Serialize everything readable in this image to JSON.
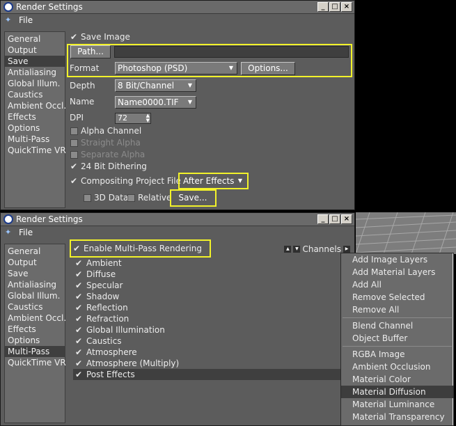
{
  "window1": {
    "title": "Render Settings",
    "menu": [
      "File"
    ],
    "sidebar": [
      "General",
      "Output",
      "Save",
      "Antialiasing",
      "Global Illum.",
      "Caustics",
      "Ambient Occl.",
      "Effects",
      "Options",
      "Multi-Pass",
      "QuickTime VR"
    ],
    "selected_sidebar": "Save",
    "save_image_label": "Save Image",
    "path_button": "Path...",
    "format_label": "Format",
    "format_value": "Photoshop (PSD)",
    "options_button": "Options...",
    "depth_label": "Depth",
    "depth_value": "8 Bit/Channel",
    "name_label": "Name",
    "name_value": "Name0000.TIF",
    "dpi_label": "DPI",
    "dpi_value": "72",
    "alpha_channel": "Alpha Channel",
    "straight_alpha": "Straight Alpha",
    "separate_alpha": "Separate Alpha",
    "dithering": "24 Bit Dithering",
    "compositing_label": "Compositing Project File",
    "compositing_value": "After Effects",
    "data_3d": "3D Data",
    "relative": "Relative",
    "save_button": "Save..."
  },
  "window2": {
    "title": "Render Settings",
    "menu": [
      "File"
    ],
    "sidebar": [
      "General",
      "Output",
      "Save",
      "Antialiasing",
      "Global Illum.",
      "Caustics",
      "Ambient Occl.",
      "Effects",
      "Options",
      "Multi-Pass",
      "QuickTime VR"
    ],
    "selected_sidebar": "Multi-Pass",
    "enable_label": "Enable Multi-Pass Rendering",
    "channels_label": "Channels",
    "passes": [
      "Ambient",
      "Diffuse",
      "Specular",
      "Shadow",
      "Reflection",
      "Refraction",
      "Global Illumination",
      "Caustics",
      "Atmosphere",
      "Atmosphere (Multiply)",
      "Post Effects"
    ],
    "selected_pass": "Post Effects"
  },
  "popup_menu": {
    "group1": [
      "Add Image Layers",
      "Add Material Layers",
      "Add All",
      "Remove Selected",
      "Remove All"
    ],
    "group2": [
      "Blend Channel",
      "Object Buffer"
    ],
    "group3": [
      "RGBA Image",
      "Ambient Occlusion",
      "Material Color",
      "Material Diffusion",
      "Material Luminance",
      "Material Transparency"
    ],
    "selected": "Material Diffusion"
  },
  "colors": {
    "highlight": "#f2f22a",
    "panel": "#5c5c5c",
    "selection": "#3f3f3f"
  }
}
